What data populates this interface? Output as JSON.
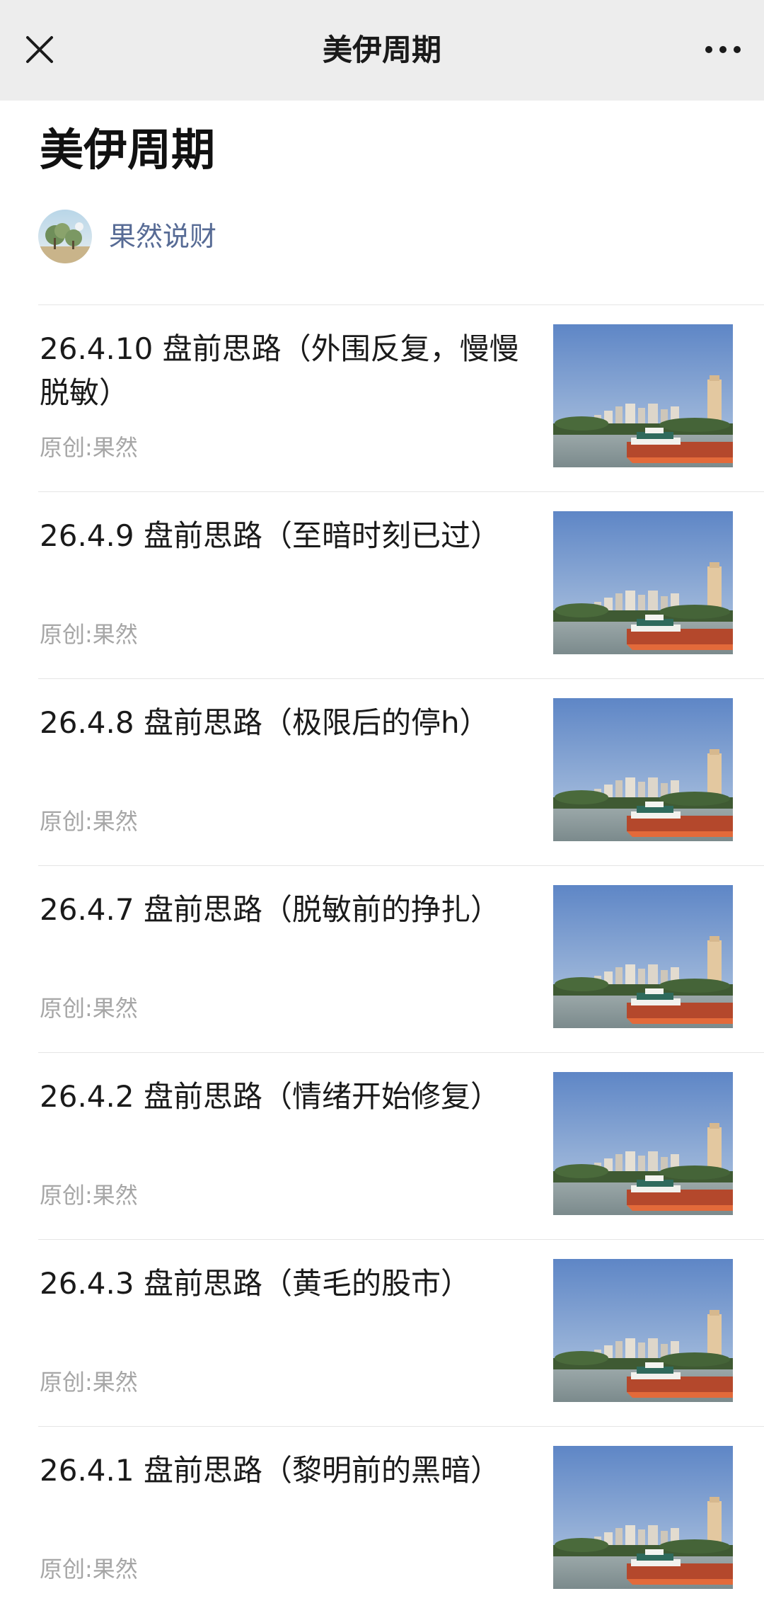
{
  "topbar": {
    "close_icon": "close-icon",
    "title": "美伊周期",
    "more_icon": "more-dots-icon"
  },
  "page": {
    "title": "美伊周期"
  },
  "author": {
    "name": "果然说财",
    "avatar_icon": "avatar-image"
  },
  "articles": [
    {
      "title": "26.4.10 盘前思路（外围反复，慢慢脱敏）",
      "meta": "原创:果然",
      "thumbnail": "river-city-boat-image"
    },
    {
      "title": "26.4.9 盘前思路（至暗时刻已过）",
      "meta": "原创:果然",
      "thumbnail": "river-city-boat-image"
    },
    {
      "title": "26.4.8 盘前思路（极限后的停h）",
      "meta": "原创:果然",
      "thumbnail": "river-city-boat-image"
    },
    {
      "title": "26.4.7 盘前思路（脱敏前的挣扎）",
      "meta": "原创:果然",
      "thumbnail": "river-city-boat-image"
    },
    {
      "title": "26.4.2 盘前思路（情绪开始修复）",
      "meta": "原创:果然",
      "thumbnail": "river-city-boat-image"
    },
    {
      "title": "26.4.3 盘前思路（黄毛的股市）",
      "meta": "原创:果然",
      "thumbnail": "river-city-boat-image"
    },
    {
      "title": "26.4.1 盘前思路（黎明前的黑暗）",
      "meta": "原创:果然",
      "thumbnail": "river-city-boat-image"
    }
  ],
  "colors": {
    "topbar_bg": "#ededed",
    "author_link": "#576b95",
    "meta_gray": "#a6a6a6",
    "divider": "#e5e5e5"
  }
}
